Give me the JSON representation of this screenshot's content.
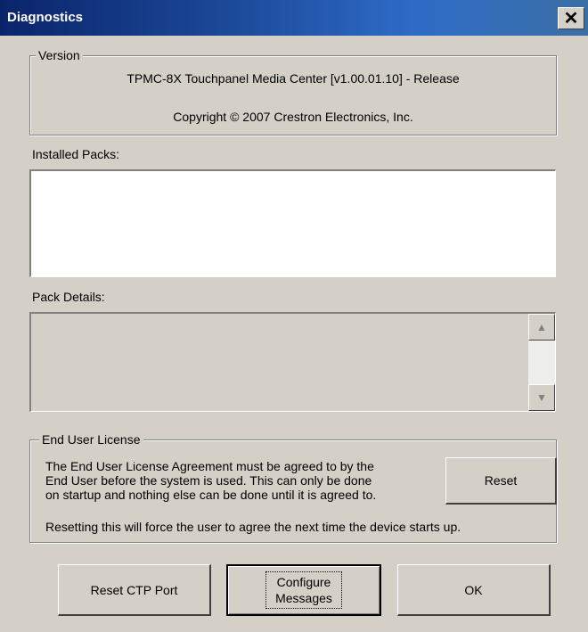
{
  "window": {
    "title": "Diagnostics",
    "close_label": "✕"
  },
  "version": {
    "legend": "Version",
    "product": "TPMC-8X Touchpanel Media Center [v1.00.01.10] - Release",
    "copyright": "Copyright © 2007 Crestron Electronics, Inc."
  },
  "installed_packs": {
    "label": "Installed Packs:",
    "items": []
  },
  "pack_details": {
    "label": "Pack Details:",
    "value": ""
  },
  "eula": {
    "legend": "End User License",
    "line1": "The End User License Agreement must be agreed to by the",
    "line2": "End User before the system is used.  This can only be done",
    "line3": "on startup and nothing else can be done until it is agreed to.",
    "reset_label": "Reset",
    "note": "Resetting this will force the user to agree the next time the device starts up."
  },
  "buttons": {
    "reset_ctp_port": "Reset CTP Port",
    "configure_messages_line1": "Configure",
    "configure_messages_line2": "Messages",
    "ok": "OK"
  }
}
